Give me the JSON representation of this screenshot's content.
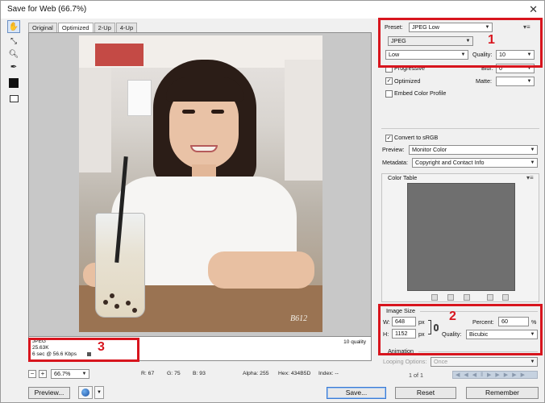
{
  "window": {
    "title": "Save for Web (66.7%)",
    "close_glyph": "✕"
  },
  "tabs": [
    "Original",
    "Optimized",
    "2-Up",
    "4-Up"
  ],
  "preview_info": {
    "format": "JPEG",
    "size": "25.63K",
    "time": "6 sec @ 56.6 Kbps",
    "quality": "10 quality",
    "watermark": "B612"
  },
  "annotations": {
    "one": "1",
    "two": "2",
    "three": "3"
  },
  "status": {
    "zoom": "66.7%",
    "r": "R: 67",
    "g": "G: 75",
    "b": "B: 93",
    "alpha": "Alpha: 255",
    "hex": "Hex: 434B5D",
    "index": "Index: --"
  },
  "settings": {
    "preset_label": "Preset:",
    "preset_value": "JPEG Low",
    "format_value": "JPEG",
    "quality_level": "Low",
    "quality_label": "Quality:",
    "quality_value": "10",
    "progressive_label": "Progressive",
    "progressive_checked": false,
    "blur_label": "Blur:",
    "blur_value": "0",
    "optimized_label": "Optimized",
    "optimized_checked": true,
    "matte_label": "Matte:",
    "embed_label": "Embed Color Profile",
    "embed_checked": false,
    "convert_label": "Convert to sRGB",
    "convert_checked": true,
    "preview_label": "Preview:",
    "preview_value": "Monitor Color",
    "metadata_label": "Metadata:",
    "metadata_value": "Copyright and Contact Info",
    "color_table_label": "Color Table"
  },
  "image_size": {
    "title": "Image Size",
    "w_label": "W:",
    "w_value": "648",
    "h_label": "H:",
    "h_value": "1152",
    "unit": "px",
    "percent_label": "Percent:",
    "percent_value": "60",
    "percent_unit": "%",
    "quality_label": "Quality:",
    "quality_value": "Bicubic"
  },
  "animation": {
    "title": "Animation",
    "looping_label": "Looping Options:",
    "looping_value": "Once",
    "frame_count": "1 of 1"
  },
  "buttons": {
    "preview": "Preview...",
    "save": "Save...",
    "reset": "Reset",
    "remember": "Remember"
  },
  "colors": {
    "accent_red": "#d8151e",
    "bg": "#f0f0f0"
  }
}
